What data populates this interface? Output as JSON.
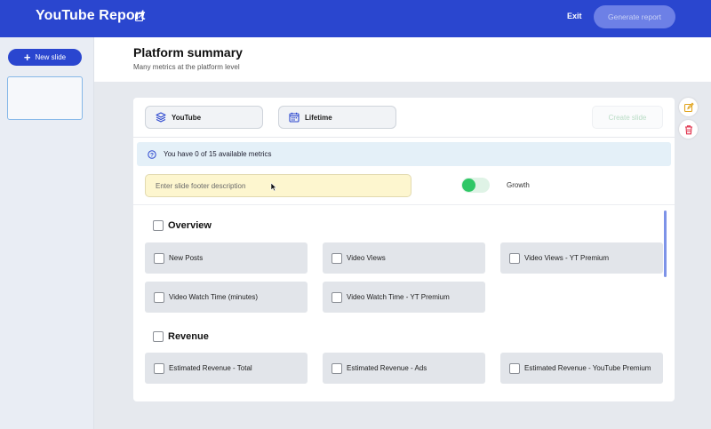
{
  "header": {
    "title": "YouTube Report",
    "exit_label": "Exit",
    "generate_label": "Generate report"
  },
  "sidebar": {
    "new_slide_label": "New slide"
  },
  "page": {
    "title": "Platform summary",
    "subtitle": "Many metrics at the platform level"
  },
  "toolbar": {
    "platform_label": "YouTube",
    "period_label": "Lifetime",
    "create_slide_label": "Create slide"
  },
  "info": {
    "text": "You have 0 of 15 available metrics"
  },
  "footer_field": {
    "placeholder": "Enter slide footer description",
    "value": ""
  },
  "growth_toggle": {
    "label": "Growth",
    "on": true
  },
  "sections": [
    {
      "title": "Overview",
      "metrics": [
        "New Posts",
        "Video Views",
        "Video Views - YT Premium",
        "Video Watch Time (minutes)",
        "Video Watch Time - YT Premium"
      ]
    },
    {
      "title": "Revenue",
      "metrics": [
        "Estimated Revenue - Total",
        "Estimated Revenue - Ads",
        "Estimated Revenue - YouTube Premium"
      ]
    }
  ],
  "colors": {
    "brand": "#2a46cf",
    "toggle_on": "#2fc766",
    "footer_highlight": "#fdf6cf",
    "info_bg": "#e4f0f8"
  },
  "icons": {
    "title_edit": "external-edit-icon",
    "platform": "layers-icon",
    "period": "calendar-icon",
    "info": "info-circle-icon",
    "edit_slide": "edit-icon",
    "delete_slide": "trash-icon"
  }
}
